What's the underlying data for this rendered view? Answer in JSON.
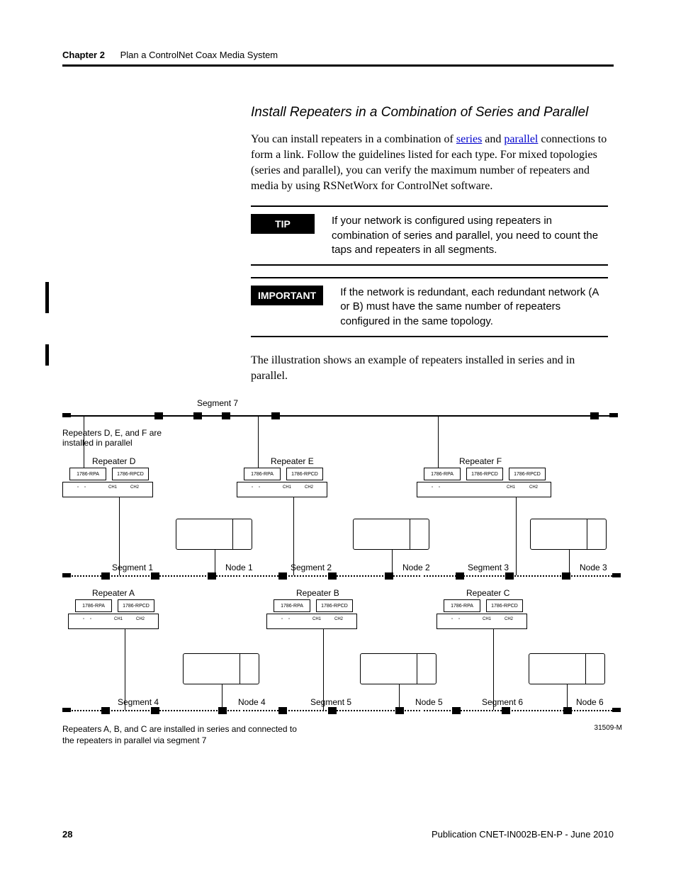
{
  "header": {
    "chapter": "Chapter 2",
    "title": "Plan a ControlNet Coax Media System"
  },
  "subhead": "Install Repeaters in a Combination of Series and Parallel",
  "para1_a": "You can install repeaters in a combination of ",
  "para1_link1": "series",
  "para1_b": " and ",
  "para1_link2": "parallel",
  "para1_c": " connections to form a link. Follow the guidelines listed for each type. For mixed topologies (series and parallel), you can verify the maximum number of repeaters and media by using RSNetWorx for ControlNet software.",
  "tip": {
    "badge": "TIP",
    "text": "If your network is configured using repeaters in combination of series and parallel, you need to count the taps and repeaters in all segments."
  },
  "important": {
    "badge": "IMPORTANT",
    "text": "If the network is redundant, each redundant network (A or B) must have the same number of repeaters configured in the same topology."
  },
  "para2": "The illustration shows an example of repeaters installed in series and in parallel.",
  "diagram": {
    "segment7": "Segment 7",
    "parallel_note": "Repeaters D, E, and F are installed in parallel",
    "repeaters_top": {
      "D": "Repeater D",
      "E": "Repeater E",
      "F": "Repeater F"
    },
    "repeaters_mid": {
      "A": "Repeater A",
      "B": "Repeater B",
      "C": "Repeater C"
    },
    "segments_mid": {
      "1": "Segment 1",
      "2": "Segment 2",
      "3": "Segment 3"
    },
    "segments_bottom": {
      "4": "Segment 4",
      "5": "Segment 5",
      "6": "Segment 6"
    },
    "nodes_mid": {
      "1": "Node 1",
      "2": "Node 2",
      "3": "Node 3"
    },
    "nodes_bottom": {
      "4": "Node 4",
      "5": "Node 5",
      "6": "Node 6"
    },
    "module_rpa": "1786-RPA",
    "module_rpcd": "1786-RPCD",
    "ch1": "CH1",
    "ch2": "CH2",
    "caption_left": "Repeaters A, B, and C are installed in series and connected to the repeaters in parallel via segment 7",
    "figure_id": "31509-M"
  },
  "footer": {
    "page": "28",
    "pub": "Publication CNET-IN002B-EN-P - June 2010"
  }
}
